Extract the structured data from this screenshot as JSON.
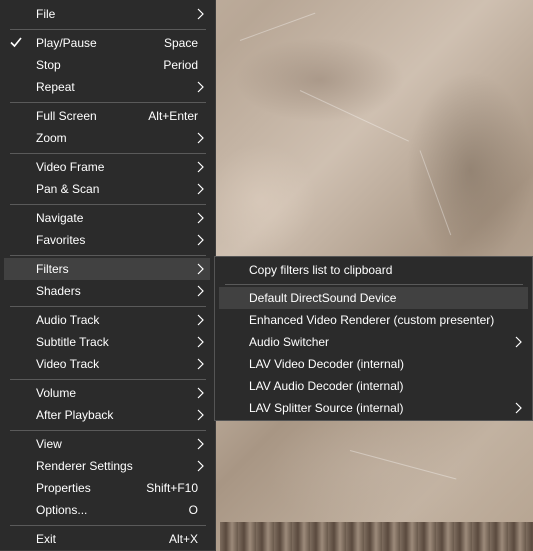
{
  "main_menu": {
    "items": [
      {
        "label": "File",
        "shortcut": "",
        "has_submenu": true
      },
      {
        "label": "Play/Pause",
        "shortcut": "Space",
        "has_submenu": false,
        "checked": true
      },
      {
        "label": "Stop",
        "shortcut": "Period",
        "has_submenu": false
      },
      {
        "label": "Repeat",
        "shortcut": "",
        "has_submenu": true
      },
      {
        "label": "Full Screen",
        "shortcut": "Alt+Enter",
        "has_submenu": false
      },
      {
        "label": "Zoom",
        "shortcut": "",
        "has_submenu": true
      },
      {
        "label": "Video Frame",
        "shortcut": "",
        "has_submenu": true
      },
      {
        "label": "Pan & Scan",
        "shortcut": "",
        "has_submenu": true
      },
      {
        "label": "Navigate",
        "shortcut": "",
        "has_submenu": true
      },
      {
        "label": "Favorites",
        "shortcut": "",
        "has_submenu": true
      },
      {
        "label": "Filters",
        "shortcut": "",
        "has_submenu": true,
        "highlighted": true
      },
      {
        "label": "Shaders",
        "shortcut": "",
        "has_submenu": true
      },
      {
        "label": "Audio Track",
        "shortcut": "",
        "has_submenu": true
      },
      {
        "label": "Subtitle Track",
        "shortcut": "",
        "has_submenu": true
      },
      {
        "label": "Video Track",
        "shortcut": "",
        "has_submenu": true
      },
      {
        "label": "Volume",
        "shortcut": "",
        "has_submenu": true
      },
      {
        "label": "After Playback",
        "shortcut": "",
        "has_submenu": true
      },
      {
        "label": "View",
        "shortcut": "",
        "has_submenu": true
      },
      {
        "label": "Renderer Settings",
        "shortcut": "",
        "has_submenu": true
      },
      {
        "label": "Properties",
        "shortcut": "Shift+F10",
        "has_submenu": false
      },
      {
        "label": "Options...",
        "shortcut": "O",
        "has_submenu": false
      },
      {
        "label": "Exit",
        "shortcut": "Alt+X",
        "has_submenu": false
      }
    ]
  },
  "filters_submenu": {
    "items": [
      {
        "label": "Copy filters list to clipboard",
        "has_submenu": false
      },
      {
        "label": "Default DirectSound Device",
        "has_submenu": false,
        "highlighted": true
      },
      {
        "label": "Enhanced Video Renderer (custom presenter)",
        "has_submenu": false
      },
      {
        "label": "Audio Switcher",
        "has_submenu": true
      },
      {
        "label": "LAV Video Decoder (internal)",
        "has_submenu": false
      },
      {
        "label": "LAV Audio Decoder (internal)",
        "has_submenu": false
      },
      {
        "label": "LAV Splitter Source (internal)",
        "has_submenu": true
      }
    ]
  },
  "icons": {
    "check": "checkmark-icon",
    "submenu": "chevron-right-icon"
  },
  "colors": {
    "menu_bg": "#2b2b2b",
    "highlight_bg": "#414141",
    "separator": "#5a5a5a",
    "text": "#ffffff"
  }
}
